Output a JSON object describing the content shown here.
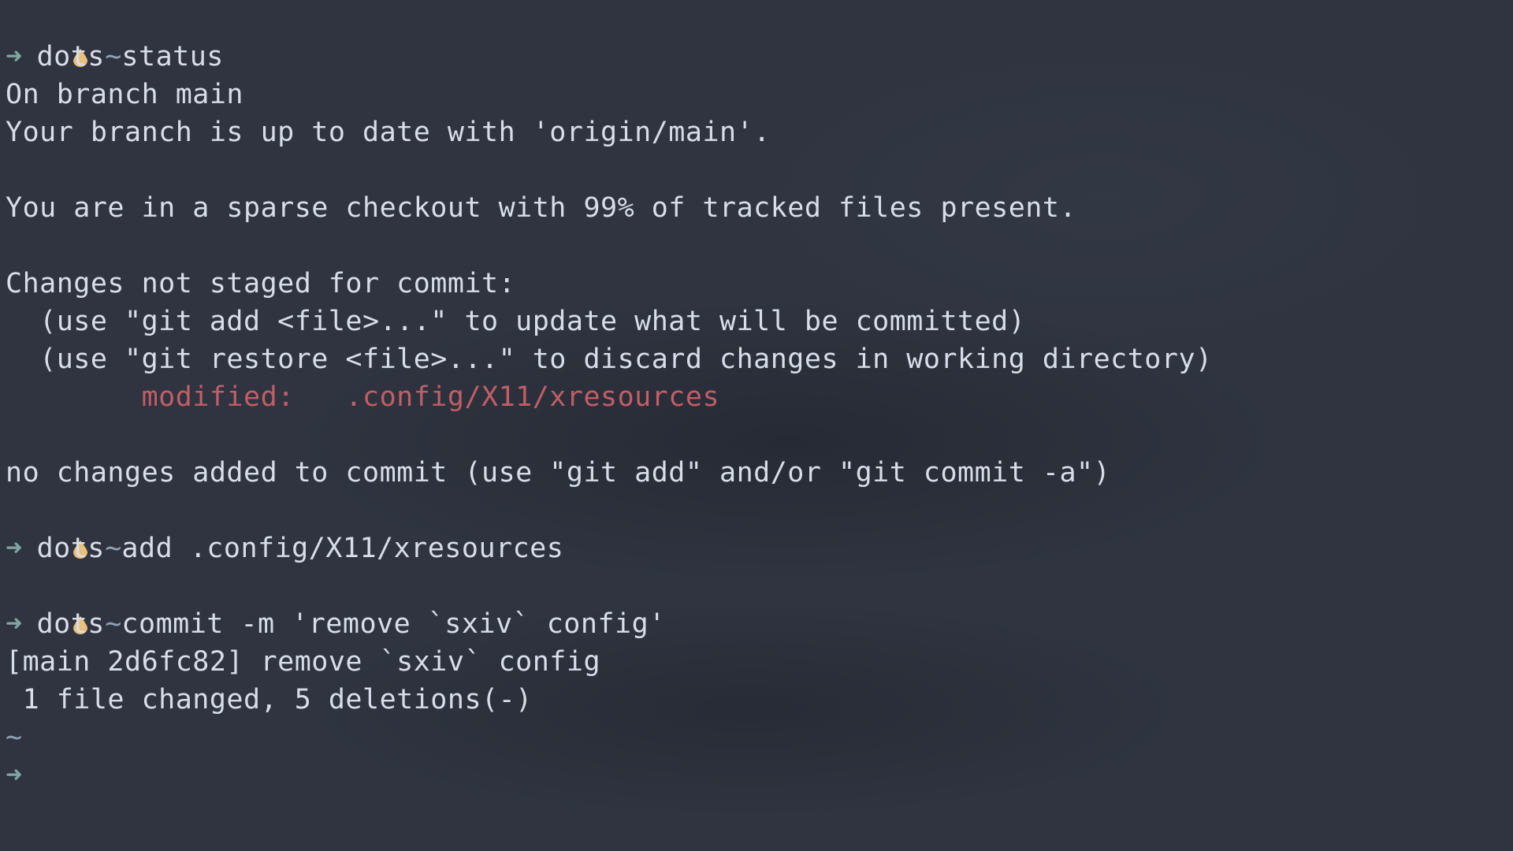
{
  "colors": {
    "background": "#2f3440",
    "foreground": "#d8dee9",
    "prompt_arrow": "#7fa7a2",
    "prompt_dir": "#8fa1b3",
    "drop_icon": "#e8c07a",
    "modified": "#c15e66"
  },
  "prompt": {
    "dir": "~",
    "arrow": "➜",
    "plain_dir": "~"
  },
  "session": {
    "cmd1": "dots status",
    "status": {
      "line1": "On branch main",
      "line2": "Your branch is up to date with 'origin/main'.",
      "line3": "You are in a sparse checkout with 99% of tracked files present.",
      "line4": "Changes not staged for commit:",
      "hint1": "  (use \"git add <file>...\" to update what will be committed)",
      "hint2": "  (use \"git restore <file>...\" to discard changes in working directory)",
      "modified_label": "        modified:   .config/X11/xresources",
      "summary": "no changes added to commit (use \"git add\" and/or \"git commit -a\")"
    },
    "cmd2": "dots add .config/X11/xresources",
    "cmd3": "dots commit -m 'remove `sxiv` config'",
    "commit": {
      "line1": "[main 2d6fc82] remove `sxiv` config",
      "line2": " 1 file changed, 5 deletions(-)"
    }
  }
}
